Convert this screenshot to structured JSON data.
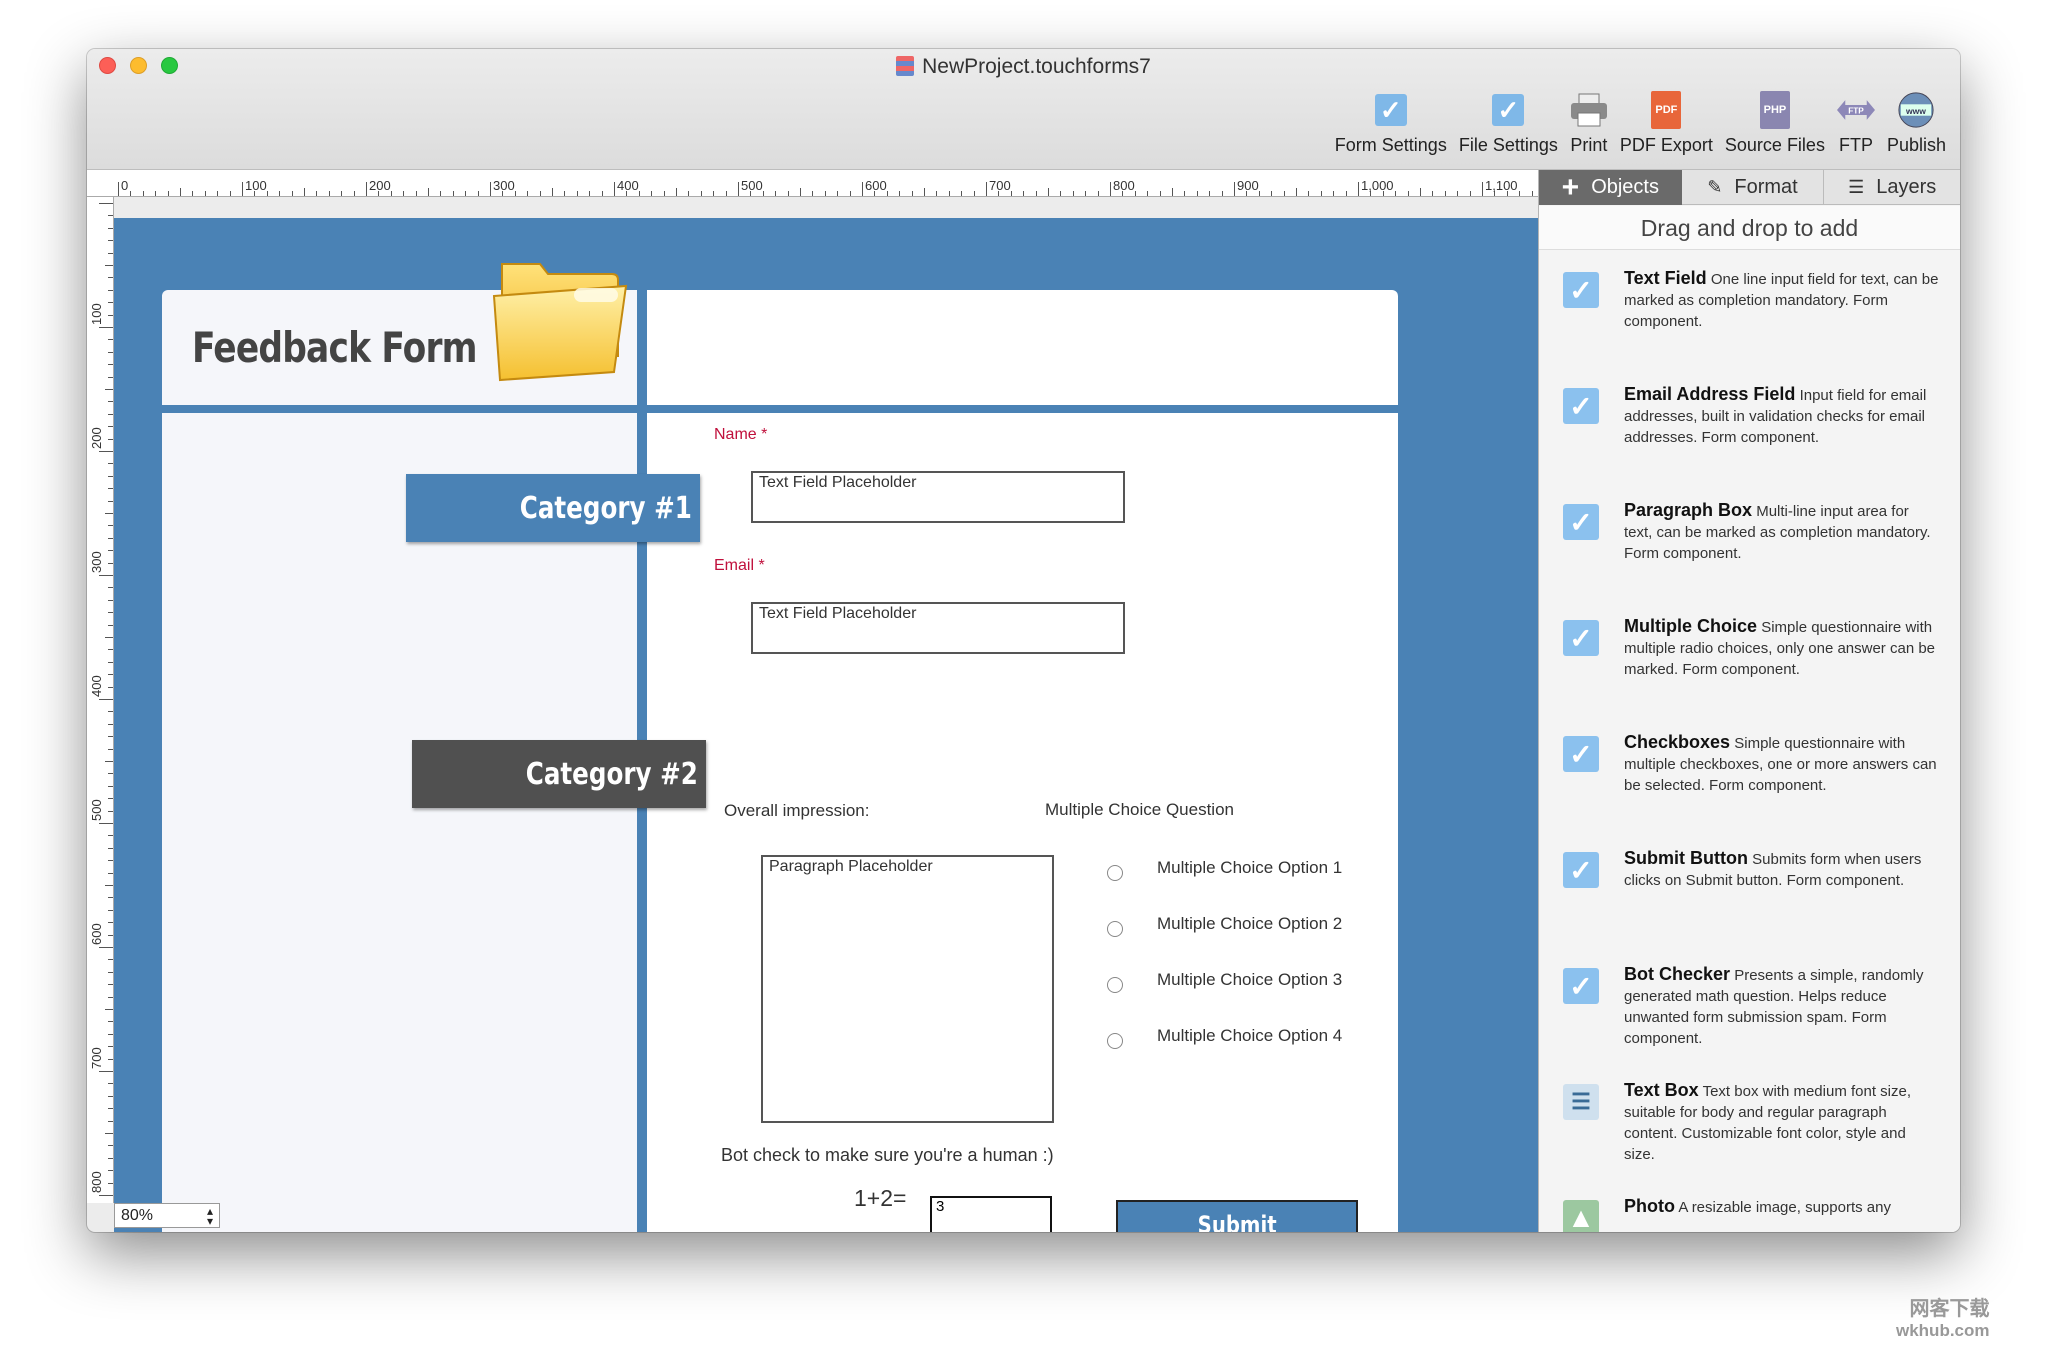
{
  "window": {
    "title": "NewProject.touchforms7"
  },
  "toolbar": [
    {
      "label": "Form Settings",
      "icon": "checkbox-icon"
    },
    {
      "label": "File Settings",
      "icon": "checkbox-icon"
    },
    {
      "label": "Print",
      "icon": "printer-icon"
    },
    {
      "label": "PDF Export",
      "icon": "pdf-icon",
      "badge": "PDF"
    },
    {
      "label": "Source Files",
      "icon": "php-icon",
      "badge": "PHP"
    },
    {
      "label": "FTP",
      "icon": "ftp-icon",
      "badge": "FTP"
    },
    {
      "label": "Publish",
      "icon": "www-icon",
      "badge": "www"
    }
  ],
  "ruler": {
    "h_labels": [
      "0",
      "100",
      "200",
      "300",
      "400",
      "500",
      "600",
      "700",
      "800",
      "900",
      "1,000",
      "1,100"
    ],
    "v_labels": [
      "100",
      "200",
      "300",
      "400",
      "500",
      "600",
      "700",
      "800"
    ]
  },
  "form": {
    "title": "Feedback Form",
    "category1": "Category #1",
    "category2": "Category #2",
    "name_label": "Name *",
    "name_placeholder": "Text Field Placeholder",
    "email_label": "Email *",
    "email_placeholder": "Text Field Placeholder",
    "overall_label": "Overall impression:",
    "paragraph_placeholder": "Paragraph Placeholder",
    "mc_question": "Multiple Choice Question",
    "mc_options": [
      "Multiple Choice Option 1",
      "Multiple Choice Option 2",
      "Multiple Choice Option 3",
      "Multiple Choice Option 4"
    ],
    "bot_text": "Bot check to make sure you're a human :)",
    "bot_equation": "1+2=",
    "bot_value": "3",
    "submit_label": "Submit"
  },
  "zoom": {
    "value": "80%"
  },
  "panel": {
    "tabs": [
      {
        "label": "Objects",
        "active": true
      },
      {
        "label": "Format",
        "active": false
      },
      {
        "label": "Layers",
        "active": false
      }
    ],
    "header": "Drag and drop to add",
    "items": [
      {
        "name": "Text Field",
        "desc": "One line input field for text, can be marked as completion mandatory.  Form component."
      },
      {
        "name": "Email Address Field",
        "desc": "Input field for email addresses, built in validation checks for email addresses.  Form component."
      },
      {
        "name": "Paragraph Box",
        "desc": "Multi-line input area for text, can be marked as completion mandatory.  Form component."
      },
      {
        "name": "Multiple Choice",
        "desc": "Simple questionnaire with multiple radio choices, only one answer can be marked.  Form component."
      },
      {
        "name": "Checkboxes",
        "desc": "Simple questionnaire with multiple checkboxes, one or more answers can be selected.  Form component."
      },
      {
        "name": "Submit Button",
        "desc": "Submits form when users clicks on Submit button.  Form component."
      },
      {
        "name": "Bot Checker",
        "desc": "Presents a simple, randomly generated math question.  Helps reduce unwanted form submission spam.  Form component."
      },
      {
        "name": "Text Box",
        "desc": "Text box with medium font size, suitable for body and regular paragraph content. Customizable font color, style and size."
      },
      {
        "name": "Photo",
        "desc": "A resizable image, supports any"
      }
    ]
  },
  "watermark": {
    "line1": "网客下载",
    "line2": "wkhub.com"
  },
  "colors": {
    "canvas": "#4a82b5",
    "category2": "#505050",
    "required": "#c0103c",
    "accent": "#8bc1ee"
  }
}
